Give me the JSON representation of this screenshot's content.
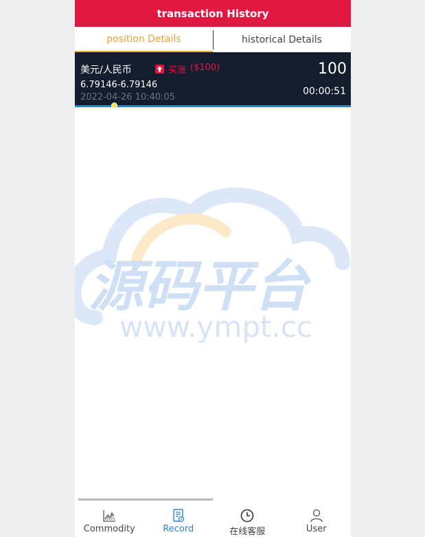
{
  "header": {
    "title": "transaction History"
  },
  "tabs": [
    {
      "label": "position Details",
      "active": true
    },
    {
      "label": "historical Details",
      "active": false
    }
  ],
  "position": {
    "pair": "美元/人民币",
    "direction": "买涨",
    "amount": "($100)",
    "price_range": "6.79146-6.79146",
    "open_time": "2022-04-26 10:40:05",
    "quantity": "100",
    "countdown": "00:00:51"
  },
  "watermark": {
    "text_cn": "源码平台",
    "text_url": "www.ympt.cc"
  },
  "bottom_nav": [
    {
      "label": "Commodity",
      "icon": "chart-icon",
      "active": false
    },
    {
      "label": "Record",
      "icon": "record-icon",
      "active": true
    },
    {
      "label": "在线客服",
      "icon": "clock-icon",
      "active": false
    },
    {
      "label": "User",
      "icon": "user-icon",
      "active": false
    }
  ],
  "colors": {
    "accent": "#e0173f",
    "tab_active": "#e9a43a",
    "card_bg": "#141d2e",
    "nav_active": "#2f80d7"
  }
}
